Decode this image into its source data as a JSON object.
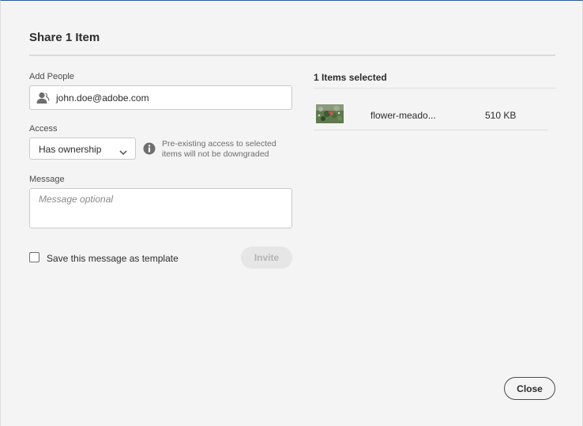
{
  "dialog": {
    "title": "Share 1 Item"
  },
  "add_people": {
    "label": "Add People",
    "value": "john.doe@adobe.com",
    "icon": "user-icon"
  },
  "access": {
    "label": "Access",
    "selected": "Has ownership",
    "info_icon": "info-icon",
    "info_text": "Pre-existing access to selected items will not be downgraded"
  },
  "message": {
    "label": "Message",
    "placeholder": "Message optional",
    "value": ""
  },
  "template": {
    "label": "Save this message as template",
    "checked": false
  },
  "buttons": {
    "invite": "Invite",
    "close": "Close"
  },
  "selection": {
    "heading": "1 Items selected",
    "items": [
      {
        "name": "flower-meado...",
        "size": "510 KB",
        "thumbnail": "flower-meadow-thumbnail"
      }
    ]
  },
  "colors": {
    "background": "#f4f4f4",
    "text": "#2c2c2c",
    "muted_text": "#6e6e6e",
    "border": "#cacaca",
    "disabled_button_bg": "#e6e6e6",
    "disabled_button_text": "#b4b4b4"
  }
}
